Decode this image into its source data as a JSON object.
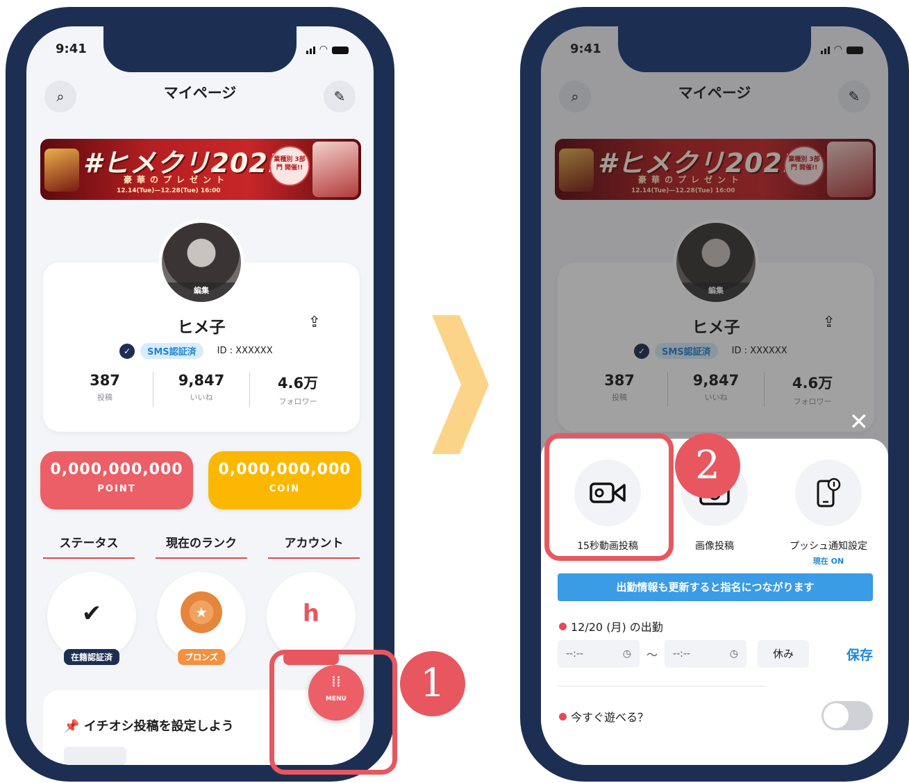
{
  "status": {
    "time": "9:41"
  },
  "header": {
    "title": "マイページ",
    "search_icon": "search-icon",
    "edit_icon": "pencil-icon"
  },
  "banner": {
    "title": "#ヒメクリ2021!",
    "subtitle": "豪華のプレゼント",
    "dates": "12.14(Tue)—12.28(Tue) 16:00",
    "seal": "業種別 3部門 開催!!"
  },
  "profile": {
    "avatar_edit": "編集",
    "name": "ヒメ子",
    "sms_badge": "SMS認証済",
    "id": "ID : XXXXXX",
    "stats": [
      {
        "value": "387",
        "label": "投稿"
      },
      {
        "value": "9,847",
        "label": "いいね"
      },
      {
        "value": "4.6万",
        "label": "フォロワー"
      }
    ]
  },
  "wallet": {
    "point_value": "0,000,000,000",
    "point_label": "POINT",
    "coin_value": "0,000,000,000",
    "coin_label": "COIN"
  },
  "sections": [
    "ステータス",
    "現在のランク",
    "アカウント"
  ],
  "badges": [
    {
      "label": "在籍認証済",
      "color": "#1c2f52"
    },
    {
      "label": "ブロンズ",
      "color": "#f2913f"
    },
    {
      "label": "",
      "color": "#e8575f"
    }
  ],
  "pickup": {
    "text": "イチオシ投稿を設定しよう"
  },
  "menu": {
    "label": "MENU"
  },
  "sheet": {
    "actions": [
      {
        "label": "15秒動画投稿",
        "icon": "video-camera-icon",
        "sub": ""
      },
      {
        "label": "画像投稿",
        "icon": "camera-icon",
        "sub": ""
      },
      {
        "label": "プッシュ通知設定",
        "icon": "phone-notification-icon",
        "sub": "現在 ON"
      }
    ],
    "info_bar": "出勤情報も更新すると指名につながります",
    "shift_label": "12/20 (月) の出勤",
    "time_placeholder": "--:--",
    "tilde": "〜",
    "rest_label": "休み",
    "save_label": "保存",
    "play_label": "今すぐ遊べる？",
    "play_enabled": false
  },
  "steps": [
    "1",
    "2"
  ],
  "colors": {
    "accent": "#e8575f",
    "navy": "#1c2f52",
    "coin": "#fcb800",
    "blue": "#1e86d7"
  }
}
